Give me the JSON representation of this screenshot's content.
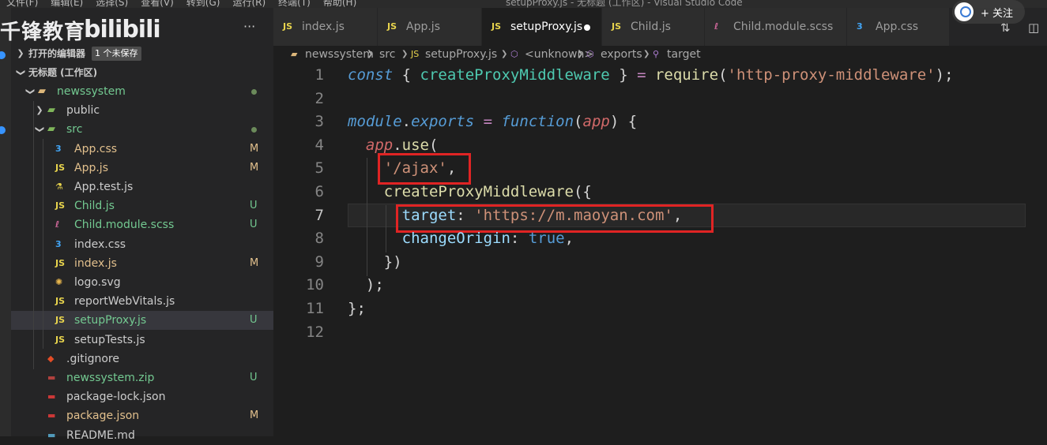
{
  "window": {
    "title": "setupProxy.js - 无标题 (工作区) - Visual Studio Code",
    "menu": [
      "文件(F)",
      "编辑(E)",
      "选择(S)",
      "查看(V)",
      "转到(G)",
      "运行(R)",
      "终端(T)",
      "帮助(H)"
    ]
  },
  "watermark": {
    "brand": "千锋教育",
    "site": "bilibili"
  },
  "follow": {
    "label": "+ 关注"
  },
  "sidebar": {
    "more": "···",
    "open_editors": {
      "label": "打开的编辑器",
      "badge": "1 个未保存"
    },
    "workspace": {
      "label": "无标题 (工作区)"
    },
    "tree": [
      {
        "label": "newssystem",
        "type": "folder",
        "status": "dot",
        "color": "#73c991"
      },
      {
        "label": "public",
        "type": "folder",
        "status": "",
        "color": "#cccccc"
      },
      {
        "label": "src",
        "type": "folder",
        "status": "dot",
        "color": "#73c991"
      },
      {
        "label": "App.css",
        "icon": "css-icon",
        "status": "M",
        "color": "#e2c08d"
      },
      {
        "label": "App.js",
        "icon": "js-icon",
        "status": "M",
        "color": "#e2c08d"
      },
      {
        "label": "App.test.js",
        "icon": "test-icon",
        "status": "",
        "color": "#cccccc"
      },
      {
        "label": "Child.js",
        "icon": "js-icon",
        "status": "U",
        "color": "#73c991"
      },
      {
        "label": "Child.module.scss",
        "icon": "scss-icon",
        "status": "U",
        "color": "#73c991"
      },
      {
        "label": "index.css",
        "icon": "css-icon",
        "status": "",
        "color": "#cccccc"
      },
      {
        "label": "index.js",
        "icon": "js-icon",
        "status": "M",
        "color": "#e2c08d"
      },
      {
        "label": "logo.svg",
        "icon": "svg-icon",
        "status": "",
        "color": "#cccccc"
      },
      {
        "label": "reportWebVitals.js",
        "icon": "js-icon",
        "status": "",
        "color": "#cccccc"
      },
      {
        "label": "setupProxy.js",
        "icon": "js-icon",
        "status": "U",
        "color": "#73c991"
      },
      {
        "label": "setupTests.js",
        "icon": "js-icon",
        "status": "",
        "color": "#cccccc"
      },
      {
        "label": ".gitignore",
        "icon": "git-icon",
        "status": "",
        "color": "#cccccc"
      },
      {
        "label": "newssystem.zip",
        "icon": "zip-icon",
        "status": "U",
        "color": "#73c991"
      },
      {
        "label": "package-lock.json",
        "icon": "npm-icon",
        "status": "",
        "color": "#cccccc"
      },
      {
        "label": "package.json",
        "icon": "npm-icon",
        "status": "M",
        "color": "#e2c08d"
      },
      {
        "label": "README.md",
        "icon": "md-icon",
        "status": "",
        "color": "#cccccc"
      }
    ]
  },
  "tabs": [
    {
      "label": "index.js",
      "icon": "JS"
    },
    {
      "label": "App.js",
      "icon": "JS"
    },
    {
      "label": "setupProxy.js",
      "icon": "JS",
      "active": true,
      "modified": true
    },
    {
      "label": "Child.js",
      "icon": "JS"
    },
    {
      "label": "Child.module.scss",
      "icon": "scss"
    },
    {
      "label": "App.css",
      "icon": "css"
    }
  ],
  "breadcrumb": [
    "newssystem",
    "src",
    "setupProxy.js",
    "<unknown>",
    "exports",
    "target"
  ],
  "editor": {
    "line_numbers": [
      "1",
      "2",
      "3",
      "4",
      "5",
      "6",
      "7",
      "8",
      "9",
      "10",
      "11",
      "12"
    ],
    "lines": [
      [
        [
          "kw",
          "const"
        ],
        [
          "p",
          " { "
        ],
        [
          "fn",
          "createProxyMiddleware"
        ],
        [
          "p",
          " } "
        ],
        [
          "op",
          "="
        ],
        [
          "p",
          " "
        ],
        [
          "fy",
          "require"
        ],
        [
          "p",
          "("
        ],
        [
          "str",
          "'http-proxy-middleware'"
        ],
        [
          "p",
          ");"
        ]
      ],
      [],
      [
        [
          "kw",
          "module"
        ],
        [
          "p",
          "."
        ],
        [
          "kw",
          "exports"
        ],
        [
          "p",
          " "
        ],
        [
          "op",
          "="
        ],
        [
          "p",
          " "
        ],
        [
          "kw",
          "function"
        ],
        [
          "p",
          "("
        ],
        [
          "var",
          "app"
        ],
        [
          "p",
          ") {"
        ]
      ],
      [
        [
          "p",
          "  "
        ],
        [
          "var",
          "app"
        ],
        [
          "p",
          "."
        ],
        [
          "fy",
          "use"
        ],
        [
          "p",
          "("
        ]
      ],
      [
        [
          "p",
          "    "
        ],
        [
          "str",
          "'/ajax'"
        ],
        [
          "p",
          ","
        ]
      ],
      [
        [
          "p",
          "    "
        ],
        [
          "fy",
          "createProxyMiddleware"
        ],
        [
          "p",
          "({"
        ]
      ],
      [
        [
          "p",
          "      "
        ],
        [
          "prop",
          "target"
        ],
        [
          "p",
          ": "
        ],
        [
          "str",
          "'https://m.maoyan.com'"
        ],
        [
          "p",
          ","
        ]
      ],
      [
        [
          "p",
          "      "
        ],
        [
          "prop",
          "changeOrigin"
        ],
        [
          "p",
          ": "
        ],
        [
          "bool",
          "true"
        ],
        [
          "p",
          ","
        ]
      ],
      [
        [
          "p",
          "    })"
        ]
      ],
      [
        [
          "p",
          "  );"
        ]
      ],
      [
        [
          "p",
          "};"
        ]
      ],
      []
    ]
  }
}
